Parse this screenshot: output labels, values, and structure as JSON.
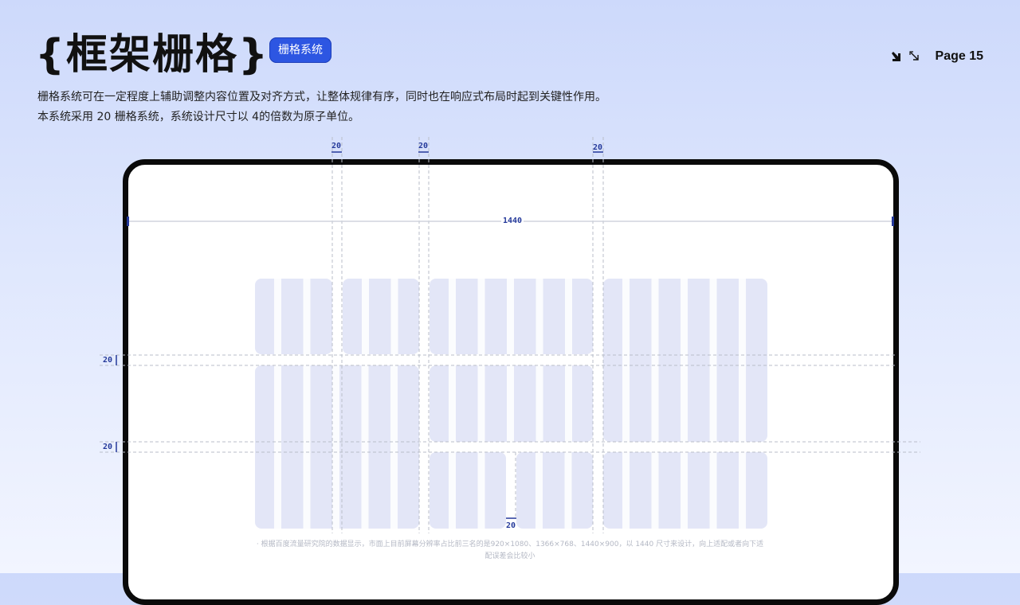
{
  "header": {
    "title": "{框架栅格}",
    "badge": "栅格系统",
    "page_label": "Page 15",
    "icons": [
      "arrow-down-right-filled-icon",
      "arrow-down-right-outline-icon"
    ]
  },
  "description": {
    "line1": "栅格系统可在一定程度上辅助调整内容位置及对齐方式，让整体规律有序，同时也在响应式布局时起到关键性作用。",
    "line2": "本系统采用 20 栅格系统，系统设计尺寸以 4的倍数为原子单位。"
  },
  "grid_diagram": {
    "width_label": "1440",
    "gutter_labels": [
      "20",
      "20",
      "20",
      "20",
      "20",
      "20"
    ],
    "column_color": "#e3e6f7",
    "accent_color": "#24399a"
  },
  "note": {
    "line1": "· 根据百度流量研究院的数据显示，市面上目前屏幕分辨率占比前三名的是920×1080、1366×768、1440×900，以 1440 尺寸来设计，向上适配或者向下适",
    "line2": "配误差会比较小"
  }
}
